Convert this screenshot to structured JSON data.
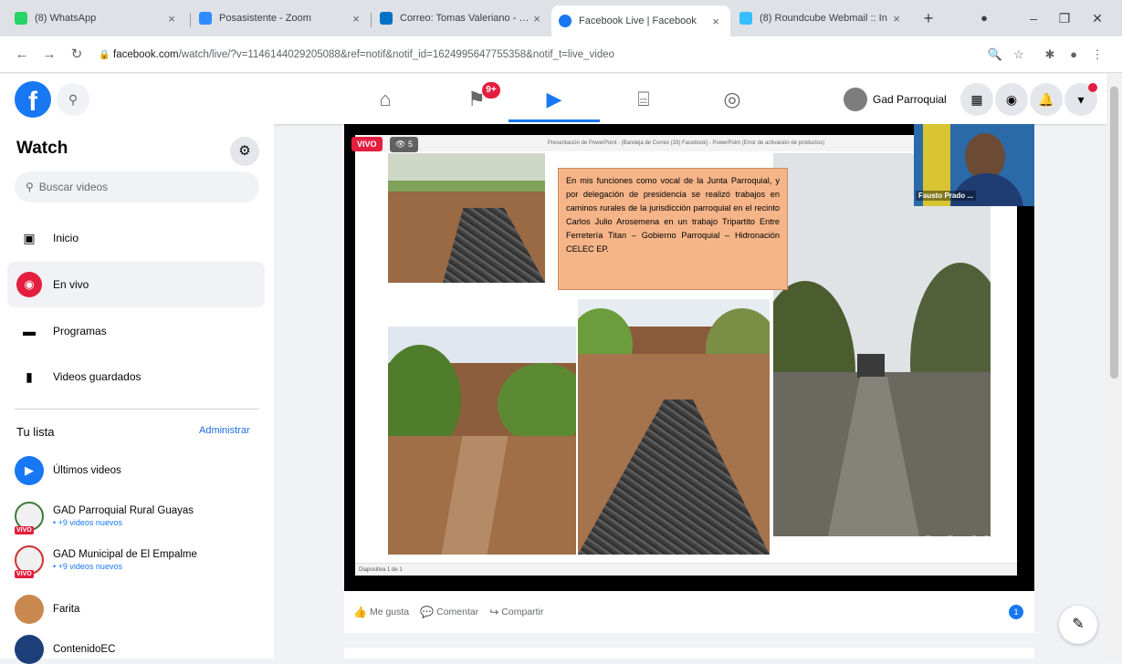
{
  "browser": {
    "tabs": [
      {
        "title": "(8) WhatsApp",
        "color": "#25d366"
      },
      {
        "title": "Posasistente - Zoom",
        "color": "#2d8cff"
      },
      {
        "title": "Correo: Tomas Valeriano - Ou",
        "color": "#0072c6"
      },
      {
        "title": "Facebook Live | Facebook",
        "color": "#1877f2"
      },
      {
        "title": "(8) Roundcube Webmail :: In",
        "color": "#37beff"
      }
    ],
    "url_host": "facebook.com",
    "url_path": "/watch/live/?v=1146144029205088&ref=notif&notif_id=1624995647755358&notif_t=live_video"
  },
  "fb": {
    "logo": "f",
    "notif_badge": "9+",
    "profile_name": "Gad Parroquial"
  },
  "sidebar": {
    "title": "Watch",
    "search_placeholder": "Buscar videos",
    "items": [
      {
        "label": "Inicio",
        "icon": "play-icon"
      },
      {
        "label": "En vivo",
        "icon": "live-icon"
      },
      {
        "label": "Programas",
        "icon": "shows-icon"
      },
      {
        "label": "Videos guardados",
        "icon": "bookmark-icon"
      }
    ],
    "list_title": "Tu lista",
    "manage": "Administrar",
    "list": [
      {
        "name": "Últimos videos",
        "sub": ""
      },
      {
        "name": "GAD Parroquial Rural Guayas",
        "sub": "• +9 videos nuevos"
      },
      {
        "name": "GAD Municipal de El Empalme",
        "sub": "• +9 videos nuevos"
      },
      {
        "name": "Farita",
        "sub": ""
      },
      {
        "name": "ContenidoEC",
        "sub": ""
      }
    ]
  },
  "video": {
    "live_label": "VIVO",
    "viewers": "5",
    "slide_header": "Presentación de PowerPoint - [Bandeja de Correo (33) Facebook] - PowerPoint (Error de activación de productos)",
    "slide_text": "En mis funciones como vocal de la Junta Parroquial, y por delegación de presidencia se realizó trabajos en caminos rurales de la jurisdicción parroquial en el recinto Carlos Julio Arosemena en un trabajo Tripartito Entre Ferretería Titan – Gobierno Parroquial – Hidronación CELEC EP.",
    "slide_footer": "Diapositiva 1 de 1",
    "participant": "Fausto Prado ...",
    "watermark": "zoom"
  },
  "actions": {
    "like": "Me gusta",
    "comment": "Comentar",
    "share": "Compartir",
    "reactions": "1"
  }
}
